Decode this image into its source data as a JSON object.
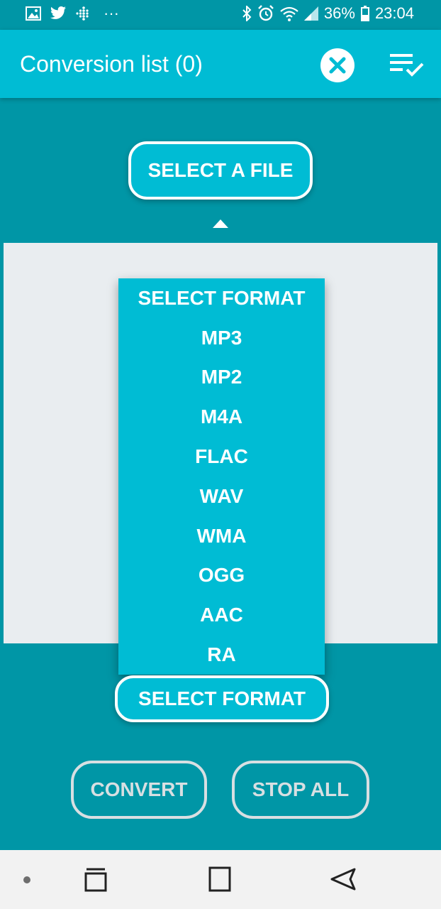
{
  "status_bar": {
    "battery_percent": "36%",
    "time": "23:04",
    "dots": "···"
  },
  "app_bar": {
    "title": "Conversion list (0)",
    "close_icon": "close-circle-icon",
    "check_list_icon": "playlist-check-icon"
  },
  "main": {
    "select_file_label": "SELECT A FILE",
    "select_format_label": "SELECT FORMAT",
    "convert_label": "CONVERT",
    "stop_all_label": "STOP ALL"
  },
  "dropdown": {
    "options": [
      "SELECT FORMAT",
      "MP3",
      "MP2",
      "M4A",
      "FLAC",
      "WAV",
      "WMA",
      "OGG",
      "AAC",
      "RA"
    ]
  },
  "nav_bar": {
    "icons": [
      "dot-icon",
      "recent-apps-icon",
      "home-icon",
      "back-icon"
    ]
  },
  "colors": {
    "primary": "#00bcd4",
    "background": "#0096a6",
    "panel": "#e9edf0"
  }
}
